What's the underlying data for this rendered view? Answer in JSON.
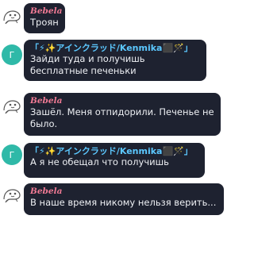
{
  "messages": [
    {
      "sender": "Bebela",
      "text": "Троян",
      "avatar": "doodle-avatar-icon"
    },
    {
      "sender": "「⚡✨アインクラッド/Kenmika⬛🪄」",
      "text": "Зайди туда и получишь бесплатные печеньки",
      "avatar_letter": "Г"
    },
    {
      "sender": "Bebela",
      "text": "Зашёл. Меня отпидорили. Печенье не было.",
      "avatar": "doodle-avatar-icon"
    },
    {
      "sender": "「⚡✨アインクラッド/Kenmika⬛🪄」",
      "text": "А я не обещал что получишь",
      "avatar_letter": "Г"
    },
    {
      "sender": "Bebela",
      "text": "В наше время никому нельзя верить...",
      "avatar": "doodle-avatar-icon"
    }
  ],
  "colors": {
    "bubble": "#1e2230",
    "bebela_name": "#f07a94",
    "kenmika_name": "#5cc8ff",
    "teal_avatar": "#2fb9a8",
    "text": "#eef0f4"
  }
}
